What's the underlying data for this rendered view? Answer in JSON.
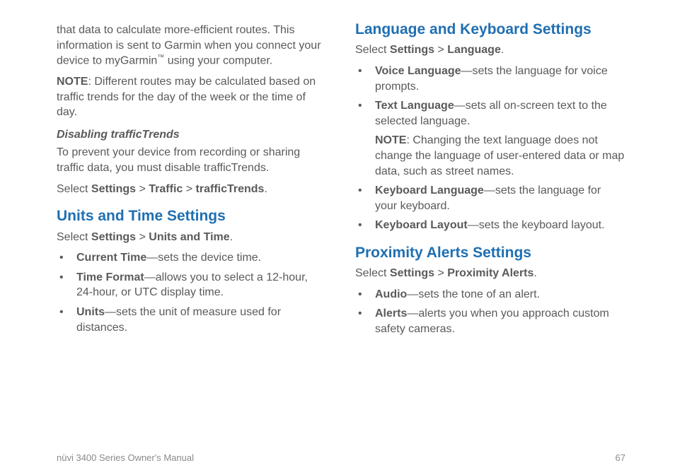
{
  "left": {
    "intro_p1_a": "that data to calculate more-efficient routes. This information is sent to Garmin when you connect your device to myGarmin",
    "intro_tm": "™",
    "intro_p1_b": " using your computer.",
    "note_label": "NOTE",
    "note_text": ": Different routes may be calculated based on traffic trends for the day of the week or the time of day.",
    "sub_heading": "Disabling trafficTrends",
    "sub_text": "To prevent your device from recording or sharing traffic data, you must disable trafficTrends.",
    "select_prefix": "Select ",
    "path_settings": "Settings",
    "path_sep": " > ",
    "path_traffic": "Traffic",
    "path_tt": "trafficTrends",
    "period": ".",
    "h_units": "Units and Time Settings",
    "units_select_prefix": "Select ",
    "units_path_settings": "Settings",
    "units_path_ut": "Units and Time",
    "items": [
      {
        "term": "Current Time",
        "desc": "—sets the device time."
      },
      {
        "term": "Time Format",
        "desc": "—allows you to select a 12-hour, 24-hour, or UTC  display time."
      },
      {
        "term": "Units",
        "desc": "—sets the unit of measure used for distances."
      }
    ]
  },
  "right": {
    "h_lang": "Language and Keyboard Settings",
    "lang_select_prefix": "Select ",
    "lang_path_settings": "Settings",
    "path_sep": " > ",
    "lang_path_lang": "Language",
    "period": ".",
    "lang_items_a": [
      {
        "term": "Voice Language",
        "desc": "—sets the language for voice prompts."
      },
      {
        "term": "Text Language",
        "desc": "—sets all on-screen text to the selected language."
      }
    ],
    "lang_note_label": "NOTE",
    "lang_note_text": ": Changing the text language does not change the language of user-entered data or map data, such as street names.",
    "lang_items_b": [
      {
        "term": "Keyboard Language",
        "desc": "—sets the language for your keyboard."
      },
      {
        "term": "Keyboard Layout",
        "desc": "—sets the keyboard layout."
      }
    ],
    "h_prox": "Proximity Alerts Settings",
    "prox_select_prefix": "Select ",
    "prox_path_settings": "Settings",
    "prox_path_pa": "Proximity Alerts",
    "prox_items": [
      {
        "term": "Audio",
        "desc": "—sets the tone of an alert."
      },
      {
        "term": "Alerts",
        "desc": "—alerts you when you approach custom safety cameras."
      }
    ]
  },
  "footer": {
    "left": "nüvi 3400 Series Owner's Manual",
    "right": "67"
  }
}
